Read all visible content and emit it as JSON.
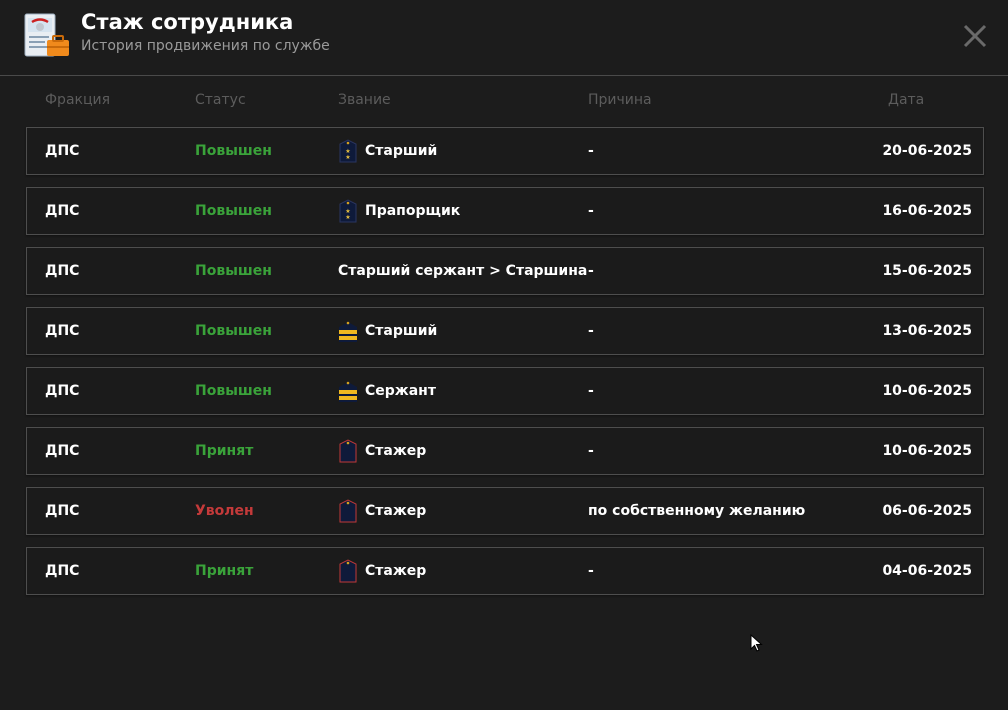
{
  "header": {
    "title": "Стаж сотрудника",
    "subtitle": "История продвижения по службе"
  },
  "columns": {
    "faction": "Фракция",
    "status": "Статус",
    "rank": "Звание",
    "reason": "Причина",
    "date": "Дата"
  },
  "colors": {
    "promoted": "#3aa33a",
    "accepted": "#3aa33a",
    "fired": "#c43a3a"
  },
  "rows": [
    {
      "faction": "ДПС",
      "status": "Повышен",
      "status_type": "green",
      "rank_icon": "epaulet-two-stars-icon",
      "rank": "Старший",
      "reason": "-",
      "date": "20-06-2025"
    },
    {
      "faction": "ДПС",
      "status": "Повышен",
      "status_type": "green",
      "rank_icon": "epaulet-two-stars-icon",
      "rank": "Прапорщик",
      "reason": "-",
      "date": "16-06-2025"
    },
    {
      "faction": "ДПС",
      "status": "Повышен",
      "status_type": "green",
      "rank_icon": "",
      "rank": "Старший сержант > Старшина",
      "reason": "-",
      "date": "15-06-2025"
    },
    {
      "faction": "ДПС",
      "status": "Повышен",
      "status_type": "green",
      "rank_icon": "epaulet-stripes-icon",
      "rank": "Старший",
      "reason": "-",
      "date": "13-06-2025"
    },
    {
      "faction": "ДПС",
      "status": "Повышен",
      "status_type": "green",
      "rank_icon": "epaulet-stripes-icon",
      "rank": "Сержант",
      "reason": "-",
      "date": "10-06-2025"
    },
    {
      "faction": "ДПС",
      "status": "Принят",
      "status_type": "green",
      "rank_icon": "epaulet-plain-icon",
      "rank": "Стажер",
      "reason": "-",
      "date": "10-06-2025"
    },
    {
      "faction": "ДПС",
      "status": "Уволен",
      "status_type": "red",
      "rank_icon": "epaulet-plain-icon",
      "rank": "Стажер",
      "reason": "по собственному желанию",
      "date": "06-06-2025"
    },
    {
      "faction": "ДПС",
      "status": "Принят",
      "status_type": "green",
      "rank_icon": "epaulet-plain-icon",
      "rank": "Стажер",
      "reason": "-",
      "date": "04-06-2025"
    }
  ],
  "icons": {
    "app": "document-briefcase-icon",
    "close": "close-icon",
    "cursor": "mouse-cursor-icon"
  }
}
